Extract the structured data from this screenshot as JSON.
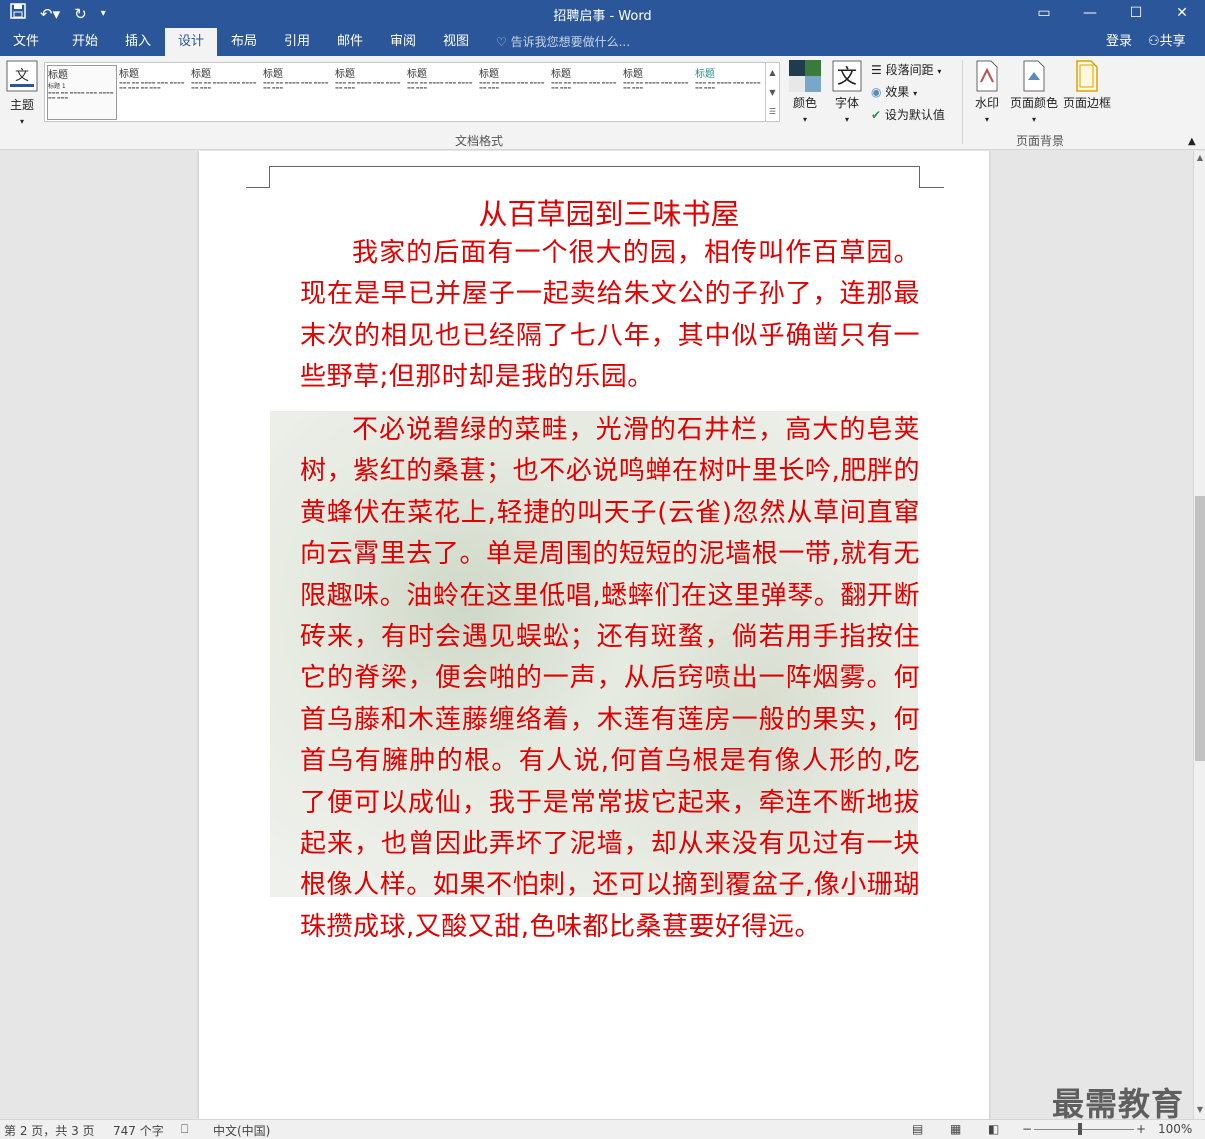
{
  "window": {
    "title": "招聘启事 - Word"
  },
  "qat": {
    "save_icon": "save-icon",
    "undo_icon": "undo-icon",
    "redo_icon": "redo-icon",
    "customize_icon": "customize-icon"
  },
  "tabs": [
    {
      "label": "文件"
    },
    {
      "label": "开始"
    },
    {
      "label": "插入"
    },
    {
      "label": "设计",
      "active": true
    },
    {
      "label": "布局"
    },
    {
      "label": "引用"
    },
    {
      "label": "邮件"
    },
    {
      "label": "审阅"
    },
    {
      "label": "视图"
    }
  ],
  "tellme": "告诉我您想要做什么...",
  "account": {
    "login": "登录",
    "share": "共享"
  },
  "ribbon": {
    "theme_label": "主题",
    "gallery_heading": "标题",
    "gallery_sub": "标题 1",
    "group_document_format": "文档格式",
    "colors_label": "颜色",
    "fonts_label": "字体",
    "paragraph_spacing": "段落间距",
    "effects": "效果",
    "set_default": "设为默认值",
    "watermark_label": "水印",
    "page_color_label": "页面颜色",
    "page_border_label": "页面边框",
    "group_page_background": "页面背景"
  },
  "document": {
    "heading": "从百草园到三味书屋",
    "paragraph1": "我家的后面有一个很大的园，相传叫作百草园。现在是早已并屋子一起卖给朱文公的子孙了，连那最末次的相见也已经隔了七八年，其中似乎确凿只有一些野草;但那时却是我的乐园。",
    "paragraph2": "不必说碧绿的菜畦，光滑的石井栏，高大的皂荚树，紫红的桑葚；也不必说鸣蝉在树叶里长吟,肥胖的黄蜂伏在菜花上,轻捷的叫天子(云雀)忽然从草间直窜向云霄里去了。单是周围的短短的泥墙根一带,就有无限趣味。油蛉在这里低唱,蟋蟀们在这里弹琴。翻开断砖来，有时会遇见蜈蚣；还有斑蝥，倘若用手指按住它的脊梁，便会啪的一声，从后窍喷出一阵烟雾。何首乌藤和木莲藤缠络着，木莲有莲房一般的果实，何首乌有臃肿的根。有人说,何首乌根是有像人形的,吃了便可以成仙，我于是常常拔它起来，牵连不断地拔起来，也曾因此弄坏了泥墙，却从来没有见过有一块根像人样。如果不怕刺，还可以摘到覆盆子,像小珊瑚珠攒成球,又酸又甜,色味都比桑葚要好得远。",
    "text_color": "#e00000"
  },
  "status": {
    "page": "第 2 页，共 3 页",
    "words": "747 个字",
    "language": "中文(中国)",
    "zoom": "100%"
  },
  "watermark_text": "最需教育"
}
